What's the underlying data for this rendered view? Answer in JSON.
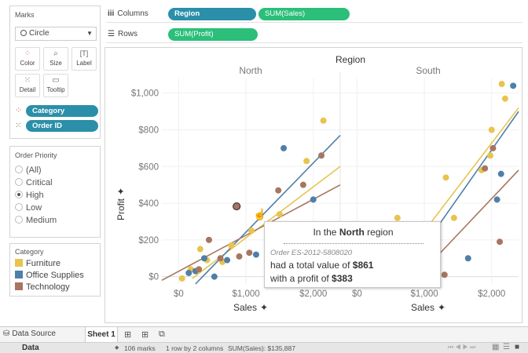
{
  "marks_card": {
    "title": "Marks",
    "mark_type": "Circle",
    "buttons": [
      {
        "label": "Color",
        "icon": "color-dots-icon"
      },
      {
        "label": "Size",
        "icon": "size-icon"
      },
      {
        "label": "Label",
        "icon": "label-icon"
      },
      {
        "label": "Detail",
        "icon": "detail-icon"
      },
      {
        "label": "Tooltip",
        "icon": "tooltip-icon"
      }
    ],
    "fields": [
      {
        "label": "Category",
        "icon": "color-dots-icon"
      },
      {
        "label": "Order ID",
        "icon": "detail-icon"
      }
    ]
  },
  "shelves": {
    "columns_label": "Columns",
    "rows_label": "Rows",
    "columns_pills": [
      "Region",
      "SUM(Sales)"
    ],
    "rows_pills": [
      "SUM(Profit)"
    ]
  },
  "filter": {
    "title": "Order Priority",
    "options": [
      "(All)",
      "Critical",
      "High",
      "Low",
      "Medium"
    ],
    "selected": "High"
  },
  "legend": {
    "title": "Category",
    "items": [
      {
        "label": "Furniture",
        "color": "#e8c44f"
      },
      {
        "label": "Office Supplies",
        "color": "#4e7fa8"
      },
      {
        "label": "Technology",
        "color": "#a77561"
      }
    ]
  },
  "chart_data": {
    "type": "scatter",
    "title": "Region",
    "panels": [
      "North",
      "South"
    ],
    "x_label": "Sales",
    "y_label": "Profit",
    "x_ticks": [
      "$0",
      "$1,000",
      "$2,000"
    ],
    "y_ticks": [
      "$0",
      "$200",
      "$400",
      "$600",
      "$800",
      "$1,000"
    ],
    "xlim": [
      -250,
      2400
    ],
    "ylim": [
      -40,
      1080
    ],
    "grid": true,
    "colors": {
      "Furniture": "#e8c44f",
      "Office Supplies": "#4e7fa8",
      "Technology": "#a77561"
    },
    "points": {
      "North": [
        {
          "cat": "Furniture",
          "x": 50,
          "y": -10
        },
        {
          "cat": "Furniture",
          "x": 180,
          "y": 40
        },
        {
          "cat": "Furniture",
          "x": 320,
          "y": 150
        },
        {
          "cat": "Furniture",
          "x": 420,
          "y": 90
        },
        {
          "cat": "Furniture",
          "x": 650,
          "y": 80
        },
        {
          "cat": "Furniture",
          "x": 780,
          "y": 170
        },
        {
          "cat": "Furniture",
          "x": 1080,
          "y": 250
        },
        {
          "cat": "Furniture",
          "x": 1500,
          "y": 340
        },
        {
          "cat": "Furniture",
          "x": 1900,
          "y": 630
        },
        {
          "cat": "Furniture",
          "x": 2150,
          "y": 850
        },
        {
          "cat": "Office Supplies",
          "x": 150,
          "y": 20
        },
        {
          "cat": "Office Supplies",
          "x": 250,
          "y": 30
        },
        {
          "cat": "Office Supplies",
          "x": 380,
          "y": 100
        },
        {
          "cat": "Office Supplies",
          "x": 530,
          "y": 0
        },
        {
          "cat": "Office Supplies",
          "x": 720,
          "y": 90
        },
        {
          "cat": "Office Supplies",
          "x": 1150,
          "y": 120
        },
        {
          "cat": "Office Supplies",
          "x": 1350,
          "y": 170
        },
        {
          "cat": "Office Supplies",
          "x": 1560,
          "y": 700
        },
        {
          "cat": "Office Supplies",
          "x": 2000,
          "y": 420
        },
        {
          "cat": "Technology",
          "x": 300,
          "y": 40
        },
        {
          "cat": "Technology",
          "x": 450,
          "y": 200
        },
        {
          "cat": "Technology",
          "x": 620,
          "y": 100
        },
        {
          "cat": "Technology",
          "x": 861,
          "y": 383
        },
        {
          "cat": "Technology",
          "x": 900,
          "y": 110
        },
        {
          "cat": "Technology",
          "x": 1050,
          "y": 130
        },
        {
          "cat": "Technology",
          "x": 1480,
          "y": 470
        },
        {
          "cat": "Technology",
          "x": 1850,
          "y": 500
        },
        {
          "cat": "Technology",
          "x": 2120,
          "y": 660
        }
      ],
      "South": [
        {
          "cat": "Furniture",
          "x": 600,
          "y": 320
        },
        {
          "cat": "Furniture",
          "x": 1100,
          "y": 10
        },
        {
          "cat": "Furniture",
          "x": 1320,
          "y": 540
        },
        {
          "cat": "Furniture",
          "x": 1440,
          "y": 320
        },
        {
          "cat": "Furniture",
          "x": 1850,
          "y": 580
        },
        {
          "cat": "Furniture",
          "x": 1980,
          "y": 660
        },
        {
          "cat": "Furniture",
          "x": 2000,
          "y": 800
        },
        {
          "cat": "Furniture",
          "x": 2150,
          "y": 1050
        },
        {
          "cat": "Furniture",
          "x": 2200,
          "y": 970
        },
        {
          "cat": "Office Supplies",
          "x": 1650,
          "y": 100
        },
        {
          "cat": "Office Supplies",
          "x": 2080,
          "y": 420
        },
        {
          "cat": "Office Supplies",
          "x": 2140,
          "y": 560
        },
        {
          "cat": "Office Supplies",
          "x": 2320,
          "y": 1040
        },
        {
          "cat": "Technology",
          "x": 1300,
          "y": 10
        },
        {
          "cat": "Technology",
          "x": 1900,
          "y": 590
        },
        {
          "cat": "Technology",
          "x": 2020,
          "y": 700
        },
        {
          "cat": "Technology",
          "x": 2120,
          "y": 190
        }
      ]
    },
    "trend_lines": {
      "North": [
        {
          "cat": "Furniture",
          "x": [
            200,
            2400
          ],
          "y": [
            -10,
            600
          ]
        },
        {
          "cat": "Office Supplies",
          "x": [
            250,
            2400
          ],
          "y": [
            -40,
            770
          ]
        },
        {
          "cat": "Technology",
          "x": [
            -250,
            2400
          ],
          "y": [
            -20,
            500
          ]
        }
      ],
      "South": [
        {
          "cat": "Furniture",
          "x": [
            400,
            2400
          ],
          "y": [
            -40,
            920
          ]
        },
        {
          "cat": "Office Supplies",
          "x": [
            600,
            2400
          ],
          "y": [
            -40,
            900
          ]
        },
        {
          "cat": "Technology",
          "x": [
            800,
            2400
          ],
          "y": [
            -40,
            580
          ]
        }
      ]
    }
  },
  "tooltip": {
    "heading_prefix": "In the",
    "heading_region": "North",
    "heading_suffix": "region",
    "order": "Order ES-2012-5808020",
    "line1_prefix": "had a total value of",
    "line1_value": "$861",
    "line2_prefix": "with a profit of",
    "line2_value": "$383"
  },
  "tabs": {
    "data_source": "Data Source",
    "sheet": "Sheet 1"
  },
  "status": {
    "left": "Data",
    "marks": "106 marks",
    "layout": "1 row by 2 columns",
    "sum": "SUM(Sales): $135,887"
  }
}
